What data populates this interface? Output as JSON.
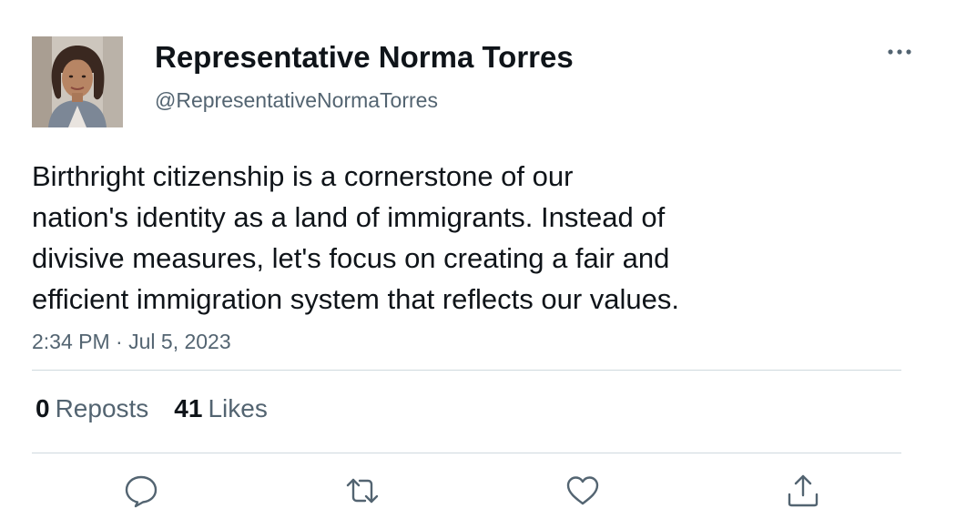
{
  "author": {
    "display_name": "Representative Norma Torres",
    "handle": "@RepresentativeNormaTorres",
    "avatar_icon": "profile-photo"
  },
  "tweet": {
    "text_lines": [
      "Birthright citizenship is a cornerstone of our",
      "nation's identity as a land of immigrants. Instead of",
      "divisive measures, let's focus on creating a fair and",
      "efficient immigration system that reflects our values."
    ],
    "time": "2:34 PM",
    "separator": "·",
    "date": "Jul 5, 2023"
  },
  "stats": {
    "reposts_count": "0",
    "reposts_label": "Reposts",
    "likes_count": "41",
    "likes_label": "Likes"
  },
  "actions": {
    "reply_icon": "speech-bubble-icon",
    "repost_icon": "repost-arrows-icon",
    "like_icon": "heart-icon",
    "share_icon": "share-upload-icon",
    "more_icon": "ellipsis-icon"
  },
  "colors": {
    "primary_text": "#0f1419",
    "secondary_text": "#536471",
    "divider": "#cfd9de"
  }
}
